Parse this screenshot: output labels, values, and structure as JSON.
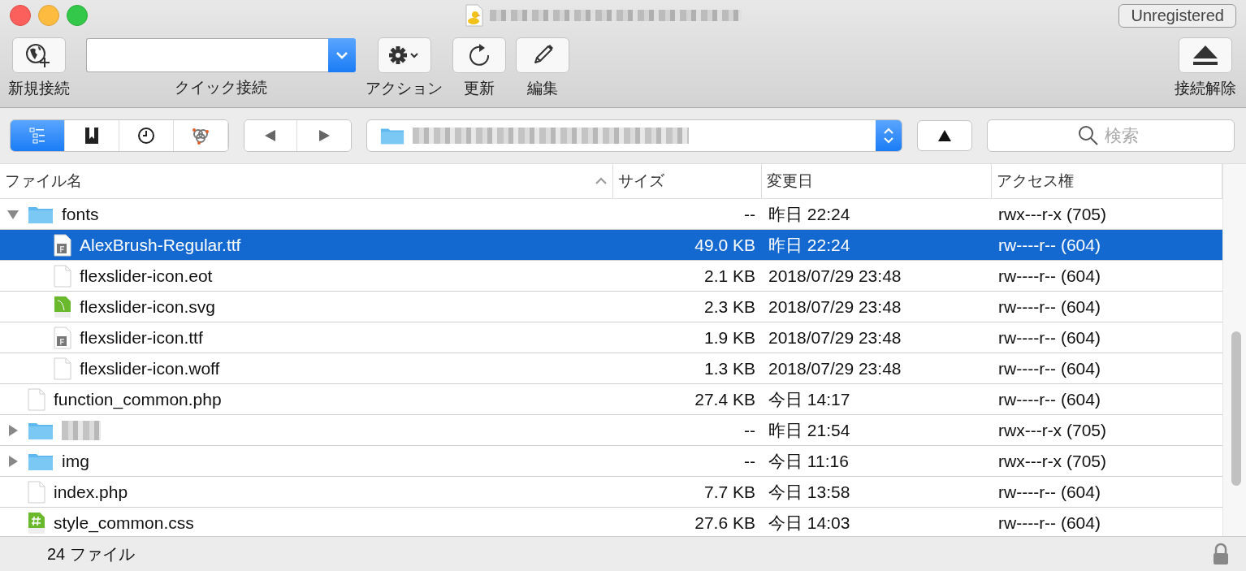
{
  "window": {
    "badge": "Unregistered"
  },
  "toolbar": {
    "items": [
      {
        "kind": "new",
        "label": "新規接続"
      },
      {
        "kind": "quick",
        "label": "クイック接続"
      },
      {
        "kind": "action",
        "label": "アクション"
      },
      {
        "kind": "refresh",
        "label": "更新"
      },
      {
        "kind": "edit",
        "label": "編集"
      }
    ],
    "disconnect": {
      "label": "接続解除"
    }
  },
  "view_switcher": [
    {
      "kind": "browser",
      "selected": true
    },
    {
      "kind": "bookmarks",
      "selected": false
    },
    {
      "kind": "history",
      "selected": false
    },
    {
      "kind": "bonjour",
      "selected": false
    }
  ],
  "search": {
    "placeholder": "検索"
  },
  "table": {
    "columns": [
      {
        "label": "ファイル名",
        "sorted": true
      },
      {
        "label": "サイズ",
        "sorted": false
      },
      {
        "label": "変更日",
        "sorted": false
      },
      {
        "label": "アクセス権",
        "sorted": false
      }
    ],
    "rows": [
      {
        "kind": "folder",
        "name": "fonts",
        "size": "--",
        "modified": "昨日 22:24",
        "permissions": "rwx---r-x (705)",
        "expanded": true,
        "selected": false,
        "children": [
          {
            "kind": "font",
            "name": "AlexBrush-Regular.ttf",
            "size": "49.0 KB",
            "modified": "昨日 22:24",
            "permissions": "rw----r-- (604)",
            "selected": true
          },
          {
            "kind": "file",
            "name": "flexslider-icon.eot",
            "size": "2.1 KB",
            "modified": "2018/07/29 23:48",
            "permissions": "rw----r-- (604)",
            "selected": false
          },
          {
            "kind": "svg",
            "name": "flexslider-icon.svg",
            "size": "2.3 KB",
            "modified": "2018/07/29 23:48",
            "permissions": "rw----r-- (604)",
            "selected": false
          },
          {
            "kind": "font",
            "name": "flexslider-icon.ttf",
            "size": "1.9 KB",
            "modified": "2018/07/29 23:48",
            "permissions": "rw----r-- (604)",
            "selected": false
          },
          {
            "kind": "file",
            "name": "flexslider-icon.woff",
            "size": "1.3 KB",
            "modified": "2018/07/29 23:48",
            "permissions": "rw----r-- (604)",
            "selected": false
          }
        ]
      },
      {
        "kind": "file",
        "name": "function_common.php",
        "size": "27.4 KB",
        "modified": "今日 14:17",
        "permissions": "rw----r-- (604)",
        "selected": false
      },
      {
        "kind": "folder",
        "size": "--",
        "modified": "昨日 21:54",
        "permissions": "rwx---r-x (705)",
        "expanded": false,
        "selected": false
      },
      {
        "kind": "folder",
        "name": "img",
        "size": "--",
        "modified": "今日 11:16",
        "permissions": "rwx---r-x (705)",
        "expanded": false,
        "selected": false
      },
      {
        "kind": "file",
        "name": "index.php",
        "size": "7.7 KB",
        "modified": "今日 13:58",
        "permissions": "rw----r-- (604)",
        "selected": false
      },
      {
        "kind": "css",
        "name": "style_common.css",
        "size": "27.6 KB",
        "modified": "今日 14:03",
        "permissions": "rw----r-- (604)",
        "selected": false
      }
    ]
  },
  "status_bar": {
    "count": "24 ファイル"
  }
}
